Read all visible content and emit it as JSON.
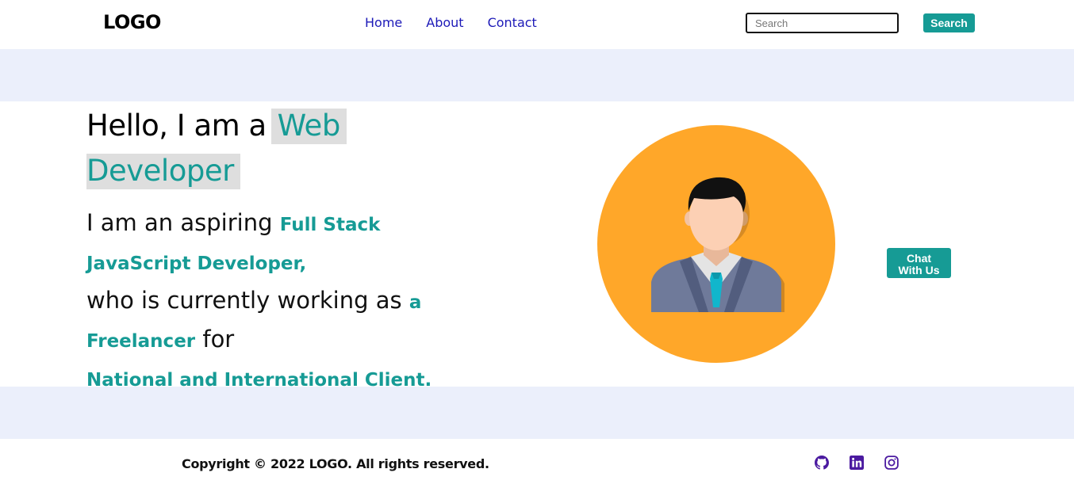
{
  "header": {
    "logo": "LOGO",
    "nav": [
      "Home",
      "About",
      "Contact"
    ],
    "search_placeholder": "Search",
    "search_button": "Search"
  },
  "hero": {
    "title_prefix": "Hello, I am a",
    "title_highlight_1": "Web",
    "title_highlight_2": "Developer",
    "line1_plain": "I am an aspiring",
    "line1_teal": "Full Stack JavaScript Developer,",
    "line2_plain": "who is currently working as",
    "line2_teal": "a Freelancer",
    "line2_plain_end": "for",
    "line3_teal": "National and International Client."
  },
  "chat": {
    "line1": "Chat",
    "line2": "With Us"
  },
  "footer": {
    "copyright": "Copyright © 2022 LOGO. All rights reserved.",
    "social_icons": [
      "github-icon",
      "linkedin-icon",
      "instagram-icon"
    ]
  },
  "colors": {
    "accent": "#169b95",
    "nav_link": "#1d1ab8",
    "band": "#ebeffb",
    "avatar_circle": "#ffa729",
    "highlight_bg": "#dedede",
    "social_icon": "#4b1aa0"
  }
}
